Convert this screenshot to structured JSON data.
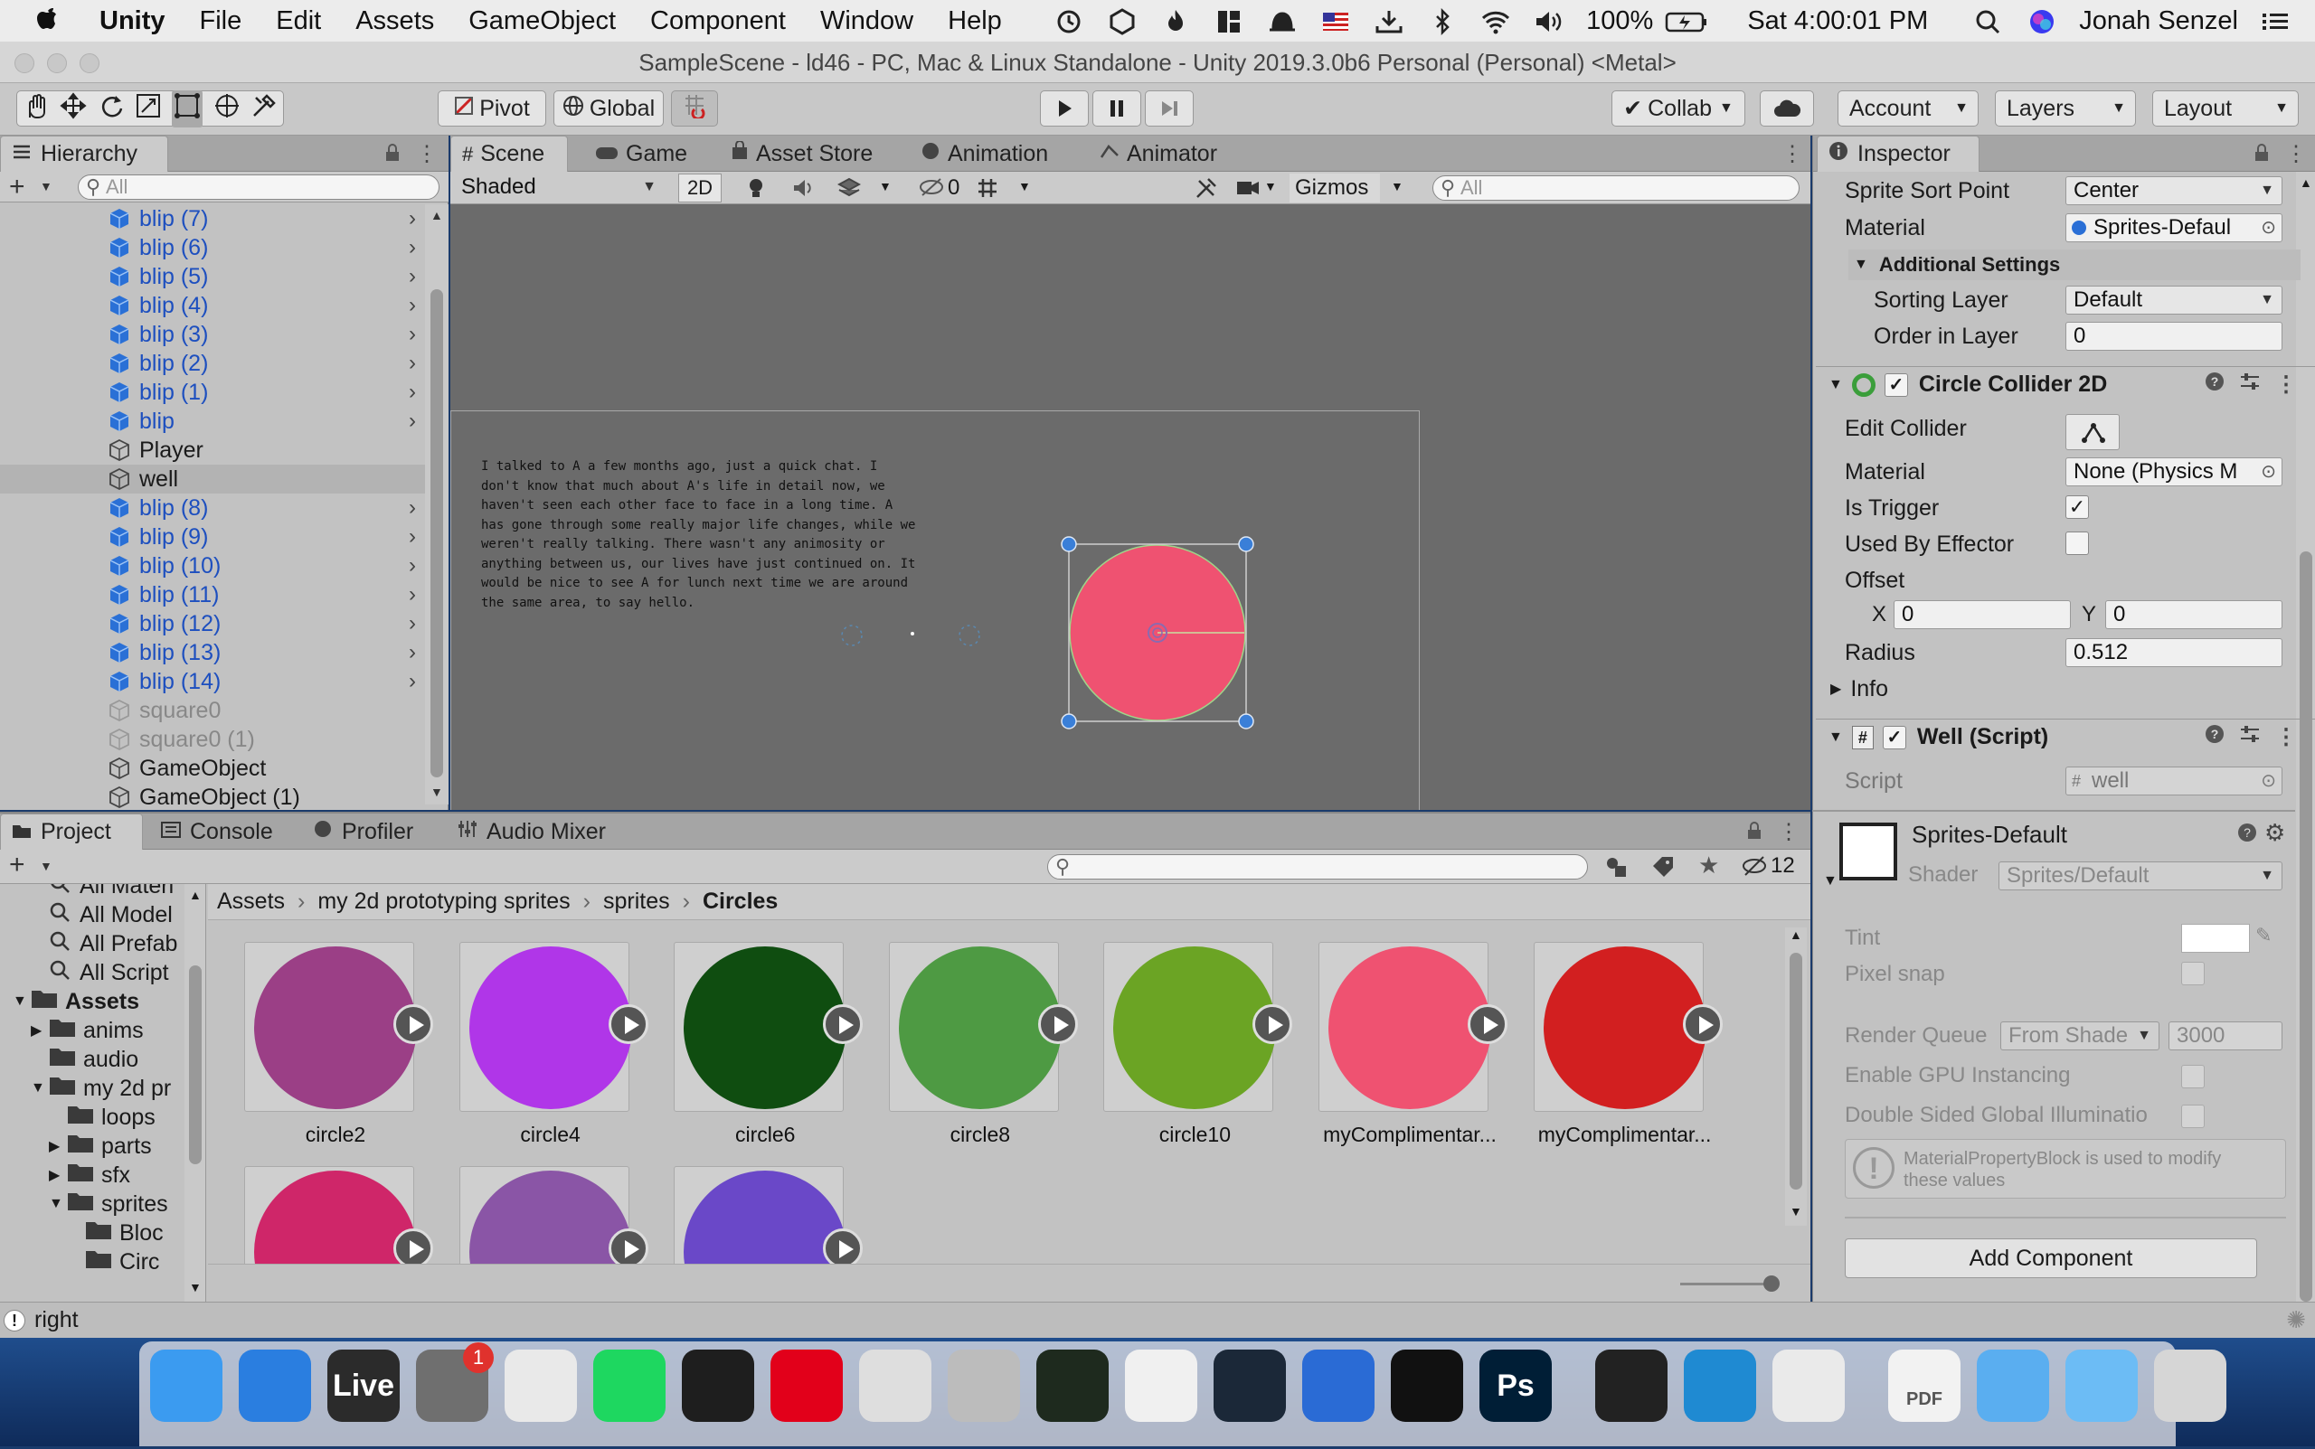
{
  "menubar": {
    "apple": "",
    "app_name": "Unity",
    "items": [
      "File",
      "Edit",
      "Assets",
      "GameObject",
      "Component",
      "Window",
      "Help"
    ],
    "battery": "100%",
    "clock": "Sat 4:00:01 PM",
    "user": "Jonah Senzel"
  },
  "window_title": "SampleScene - ld46 - PC, Mac & Linux Standalone - Unity 2019.3.0b6 Personal (Personal) <Metal>",
  "toolbar": {
    "pivot": "Pivot",
    "global": "Global",
    "collab": "Collab",
    "account": "Account",
    "layers": "Layers",
    "layout": "Layout"
  },
  "hierarchy": {
    "tab": "Hierarchy",
    "search_placeholder": "All",
    "rows": [
      {
        "name": "blip (7)",
        "kind": "prefab",
        "children": true
      },
      {
        "name": "blip (6)",
        "kind": "prefab",
        "children": true
      },
      {
        "name": "blip (5)",
        "kind": "prefab",
        "children": true
      },
      {
        "name": "blip (4)",
        "kind": "prefab",
        "children": true
      },
      {
        "name": "blip (3)",
        "kind": "prefab",
        "children": true
      },
      {
        "name": "blip (2)",
        "kind": "prefab",
        "children": true
      },
      {
        "name": "blip (1)",
        "kind": "prefab",
        "children": true
      },
      {
        "name": "blip",
        "kind": "prefab",
        "children": true
      },
      {
        "name": "Player",
        "kind": "object",
        "children": false
      },
      {
        "name": "well",
        "kind": "object",
        "children": false,
        "selected": true
      },
      {
        "name": "blip (8)",
        "kind": "prefab",
        "children": true
      },
      {
        "name": "blip (9)",
        "kind": "prefab",
        "children": true
      },
      {
        "name": "blip (10)",
        "kind": "prefab",
        "children": true
      },
      {
        "name": "blip (11)",
        "kind": "prefab",
        "children": true
      },
      {
        "name": "blip (12)",
        "kind": "prefab",
        "children": true
      },
      {
        "name": "blip (13)",
        "kind": "prefab",
        "children": true
      },
      {
        "name": "blip (14)",
        "kind": "prefab",
        "children": true
      },
      {
        "name": "square0",
        "kind": "disabled",
        "children": false
      },
      {
        "name": "square0 (1)",
        "kind": "disabled",
        "children": false
      },
      {
        "name": "GameObject",
        "kind": "object",
        "children": false
      },
      {
        "name": "GameObject (1)",
        "kind": "object",
        "children": false
      }
    ]
  },
  "scene": {
    "tabs": [
      "Scene",
      "Game",
      "Asset Store",
      "Animation",
      "Animator"
    ],
    "shading": "Shaded",
    "mode_2d": "2D",
    "hidden_count": "0",
    "gizmos": "Gizmos",
    "search_placeholder": "All",
    "story_lines": [
      "I talked to A a few months ago, just a quick chat. I",
      "don't know that much about A's life in detail now, we",
      "haven't seen each other face to face in a long time. A",
      "has gone through some really major life changes, while we",
      "weren't really talking. There wasn't any animosity or",
      "anything between us, our lives have just continued on. It",
      "would be nice to see A for lunch next time we are around",
      "the same area, to say hello."
    ],
    "well_color": "#ef5271"
  },
  "inspector": {
    "tab": "Inspector",
    "sprite_sort_point_label": "Sprite Sort Point",
    "sprite_sort_point": "Center",
    "material_label": "Material",
    "material": "Sprites-Defaul",
    "additional_settings": "Additional Settings",
    "sorting_layer_label": "Sorting Layer",
    "sorting_layer": "Default",
    "order_label": "Order in Layer",
    "order": "0",
    "collider_title": "Circle Collider 2D",
    "edit_collider_label": "Edit Collider",
    "collider_material_label": "Material",
    "collider_material": "None (Physics M",
    "is_trigger_label": "Is Trigger",
    "is_trigger": "✓",
    "used_by_effector_label": "Used By Effector",
    "offset_label": "Offset",
    "x_label": "X",
    "x": "0",
    "y_label": "Y",
    "y": "0",
    "radius_label": "Radius",
    "radius": "0.512",
    "info_label": "Info",
    "script_title": "Well (Script)",
    "script_label": "Script",
    "script": "well",
    "mat_name": "Sprites-Default",
    "shader_label": "Shader",
    "shader": "Sprites/Default",
    "tint_label": "Tint",
    "pixel_snap_label": "Pixel snap",
    "render_queue_label": "Render Queue",
    "render_queue_mode": "From Shade",
    "render_queue": "3000",
    "gpu_label": "Enable GPU Instancing",
    "double_sided_label": "Double Sided Global Illuminatio",
    "mpb_note_1": "MaterialPropertyBlock is used to modify",
    "mpb_note_2": "these values",
    "add_component": "Add Component"
  },
  "project": {
    "tabs": [
      "Project",
      "Console",
      "Profiler",
      "Audio Mixer"
    ],
    "hidden_count": "12",
    "breadcrumb": [
      "Assets",
      "my 2d prototyping sprites",
      "sprites",
      "Circles"
    ],
    "tree": [
      {
        "label": "All Materi",
        "indent": 1,
        "kind": "search"
      },
      {
        "label": "All Model",
        "indent": 1,
        "kind": "search"
      },
      {
        "label": "All Prefab",
        "indent": 1,
        "kind": "search"
      },
      {
        "label": "All Script",
        "indent": 1,
        "kind": "search"
      },
      {
        "label": "Assets",
        "indent": 0,
        "kind": "folder-open",
        "bold": true
      },
      {
        "label": "anims",
        "indent": 1,
        "kind": "folder"
      },
      {
        "label": "audio",
        "indent": 1,
        "kind": "folder"
      },
      {
        "label": "my 2d pr",
        "indent": 1,
        "kind": "folder-open"
      },
      {
        "label": "loops",
        "indent": 2,
        "kind": "folder"
      },
      {
        "label": "parts",
        "indent": 2,
        "kind": "folder"
      },
      {
        "label": "sfx",
        "indent": 2,
        "kind": "folder"
      },
      {
        "label": "sprites",
        "indent": 2,
        "kind": "folder-open"
      },
      {
        "label": "Bloc",
        "indent": 3,
        "kind": "folder"
      },
      {
        "label": "Circ",
        "indent": 3,
        "kind": "folder"
      }
    ],
    "assets": [
      {
        "name": "circle2",
        "color": "#9b3f86"
      },
      {
        "name": "circle4",
        "color": "#b036e8"
      },
      {
        "name": "circle6",
        "color": "#0f4d10"
      },
      {
        "name": "circle8",
        "color": "#4e9a43"
      },
      {
        "name": "circle10",
        "color": "#6ba424"
      },
      {
        "name": "myComplimentar...",
        "color": "#ef5271"
      },
      {
        "name": "myComplimentar...",
        "color": "#d21f20"
      },
      {
        "name": "",
        "color": "#cf2669"
      },
      {
        "name": "",
        "color": "#8a55a6"
      },
      {
        "name": "",
        "color": "#6a48c8"
      }
    ]
  },
  "status": {
    "message": "right"
  },
  "dock": [
    {
      "name": "finder-icon",
      "color": "#3b9bf0"
    },
    {
      "name": "safari-icon",
      "color": "#2a7ee0"
    },
    {
      "name": "ableton-live-icon",
      "color": "#2b2b2b",
      "label": "Live"
    },
    {
      "name": "system-preferences-icon",
      "color": "#6f6f6f",
      "badge": "1"
    },
    {
      "name": "chrome-icon",
      "color": "#e9e9e9"
    },
    {
      "name": "spotify-icon",
      "color": "#1ed760"
    },
    {
      "name": "terminal-icon",
      "color": "#1e1e1e"
    },
    {
      "name": "opera-icon",
      "color": "#e2001a"
    },
    {
      "name": "preview-icon",
      "color": "#dedede"
    },
    {
      "name": "rocket-icon",
      "color": "#bcbcbc"
    },
    {
      "name": "activity-monitor-icon",
      "color": "#1e2a1e"
    },
    {
      "name": "unity-hub-icon",
      "color": "#f0f0f0"
    },
    {
      "name": "steam-icon",
      "color": "#1b2838"
    },
    {
      "name": "sourcetree-icon",
      "color": "#2a6bd5"
    },
    {
      "name": "text-editor-icon",
      "color": "#111111"
    },
    {
      "name": "photoshop-icon",
      "color": "#001e36",
      "label": "Ps"
    },
    {
      "name": "unity-icon",
      "color": "#222222"
    },
    {
      "name": "vscode-icon",
      "color": "#1f8ad2"
    },
    {
      "name": "textedit-icon",
      "color": "#eaeaea"
    },
    {
      "name": "pdf-document-icon",
      "color": "#f2f2f2",
      "label": "PDF"
    },
    {
      "name": "folder-stack-icon",
      "color": "#5aaef0"
    },
    {
      "name": "downloads-folder-icon",
      "color": "#6cbcf5"
    },
    {
      "name": "trash-icon",
      "color": "#d6d6d6"
    }
  ]
}
